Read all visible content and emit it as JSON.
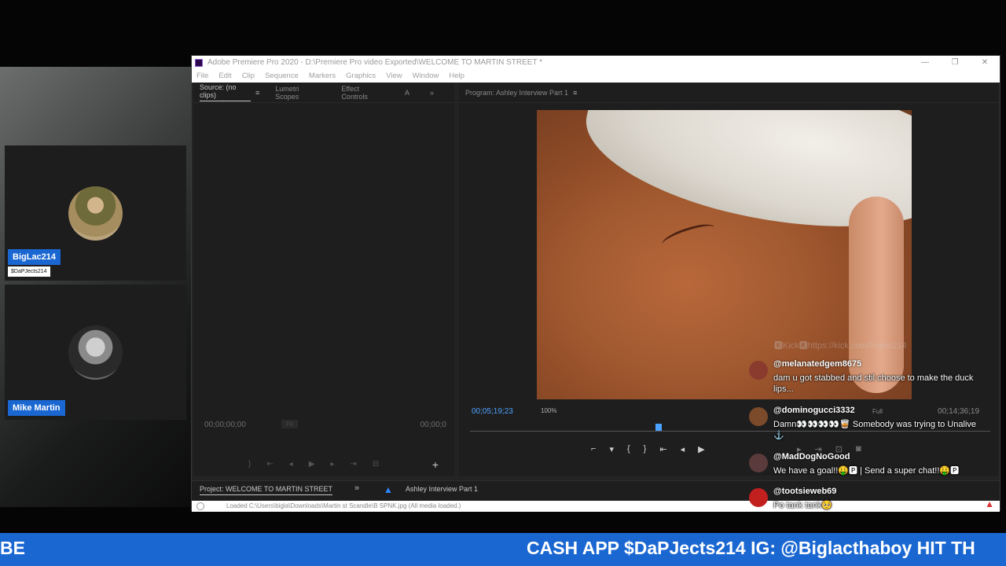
{
  "premiere": {
    "title": "Adobe Premiere Pro 2020 - D:\\Premiere Pro video Exported\\WELCOME TO MARTIN STREET *",
    "window_controls": [
      "—",
      "❐",
      "✕"
    ],
    "menu": [
      "File",
      "Edit",
      "Clip",
      "Sequence",
      "Markers",
      "Graphics",
      "View",
      "Window",
      "Help"
    ],
    "source_tabs": [
      "Source: (no clips)",
      "Lumetri Scopes",
      "Effect Controls",
      "A"
    ],
    "source_timecode": "00;00;00;00",
    "source_timecode_end": "00;00;0",
    "source_fit": "Fit",
    "program_tab": "Program: Ashley Interview Part 1",
    "program_timecode": "00;05;19;23",
    "program_zoom": "100%",
    "program_fit": "Full",
    "program_duration": "00;14;36;19",
    "project_tab": "Project: WELCOME TO MARTIN STREET",
    "sequence_tab": "Ashley Interview Part 1",
    "status_text": "Loaded C:\\Users\\bigla\\Downloads\\Martin st Scandle\\B SPNK.jpg (All media loaded.)"
  },
  "cams": [
    {
      "name": "BigLac214",
      "sub": "$DaPJects214"
    },
    {
      "name": "Mike Martin"
    }
  ],
  "chat": {
    "header": "🅺Kick🅺https://kick.com/biglac214",
    "messages": [
      {
        "user": "@melanatedgem8675",
        "text": "dam u got stabbed and stil choose to make the duck lips..."
      },
      {
        "user": "@dominogucci3332",
        "text": "Damn👀👀👀👀🥃 Somebody was trying to Unalive ⚓"
      },
      {
        "user": "@MadDogNoGood",
        "text": "We have a goal!!🤑🅿 | Send a super chat!!🤑🅿"
      },
      {
        "user": "@tootsieweb69",
        "text": "Po tank tank🥺"
      }
    ],
    "colors": {
      "avatar1": "#8a3b2e",
      "avatar2": "#7a4a2a",
      "avatar3": "#5a3a3a",
      "avatar4": "#c21f1f"
    }
  },
  "ticker": {
    "left": "BE",
    "right": "CASH APP $DaPJects214 IG: @Biglacthaboy HIT TH"
  }
}
